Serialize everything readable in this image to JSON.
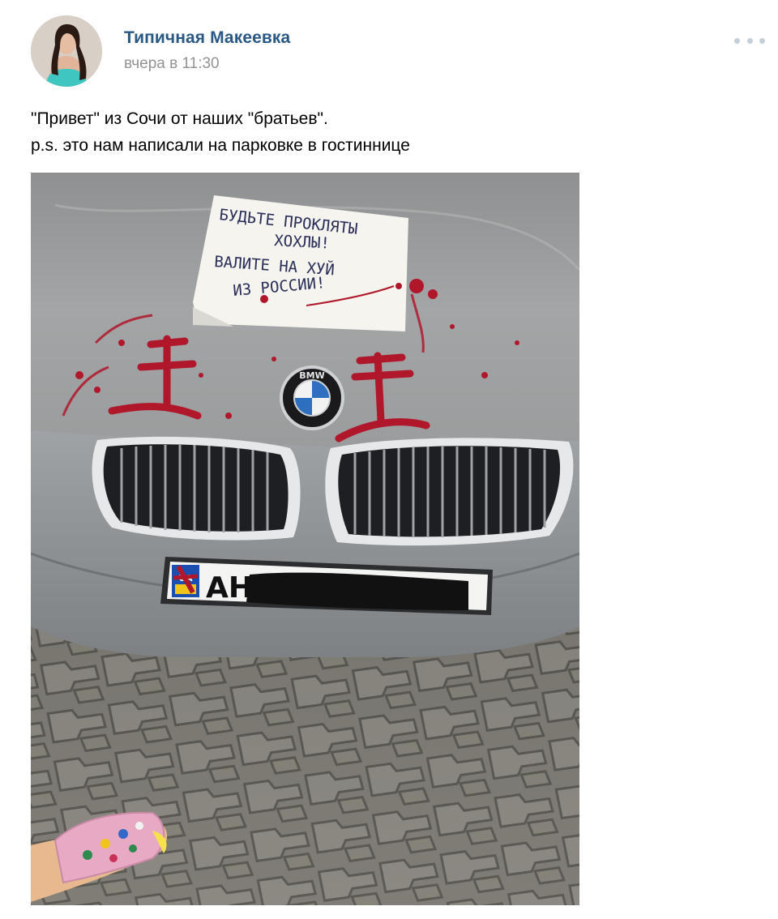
{
  "post": {
    "author": "Типичная Макеевка",
    "timestamp": "вчера в 11:30",
    "text_lines": [
      "\"Привет\" из Сочи от наших \"братьев\".",
      "p.s. это нам написали на парковке в гостиннице"
    ]
  },
  "photo": {
    "note_lines": [
      "БУДЬТЕ ПРОКЛЯТЫ",
      "ХОХЛЫ!",
      "ВАЛИТЕ НА ХУЙ",
      "ИЗ РОССИИ!"
    ],
    "badge_text": "BMW",
    "plate_country": "UA",
    "plate_text": "AH"
  },
  "icons": {
    "more": "more-horizontal-icon",
    "avatar": "user-avatar"
  },
  "colors": {
    "author_link": "#2a5885",
    "timestamp": "#939393",
    "more_dots": "#c5cfd9"
  }
}
